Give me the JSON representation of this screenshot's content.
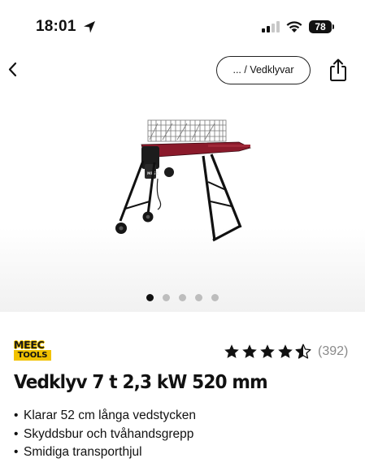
{
  "status_bar": {
    "time": "18:01",
    "battery_level": "78"
  },
  "nav": {
    "breadcrumb": "... / Vedklyvar"
  },
  "gallery": {
    "image_count": 5,
    "active_index": 0
  },
  "product": {
    "brand": {
      "line1": "MEEC",
      "line2": "TOOLS"
    },
    "rating": {
      "stars": 4.5,
      "max": 5,
      "review_count": "(392)"
    },
    "title": "Vedklyv 7 t 2,3 kW 520 mm",
    "features": [
      "Klarar 52 cm långa vedstycken",
      "Skyddsbur och tvåhandsgrepp",
      "Smidiga transporthjul"
    ]
  },
  "colors": {
    "brand_yellow": "#f2c200",
    "splitter_red": "#8b1a2b",
    "text": "#111111",
    "muted": "#8a8a8a"
  }
}
